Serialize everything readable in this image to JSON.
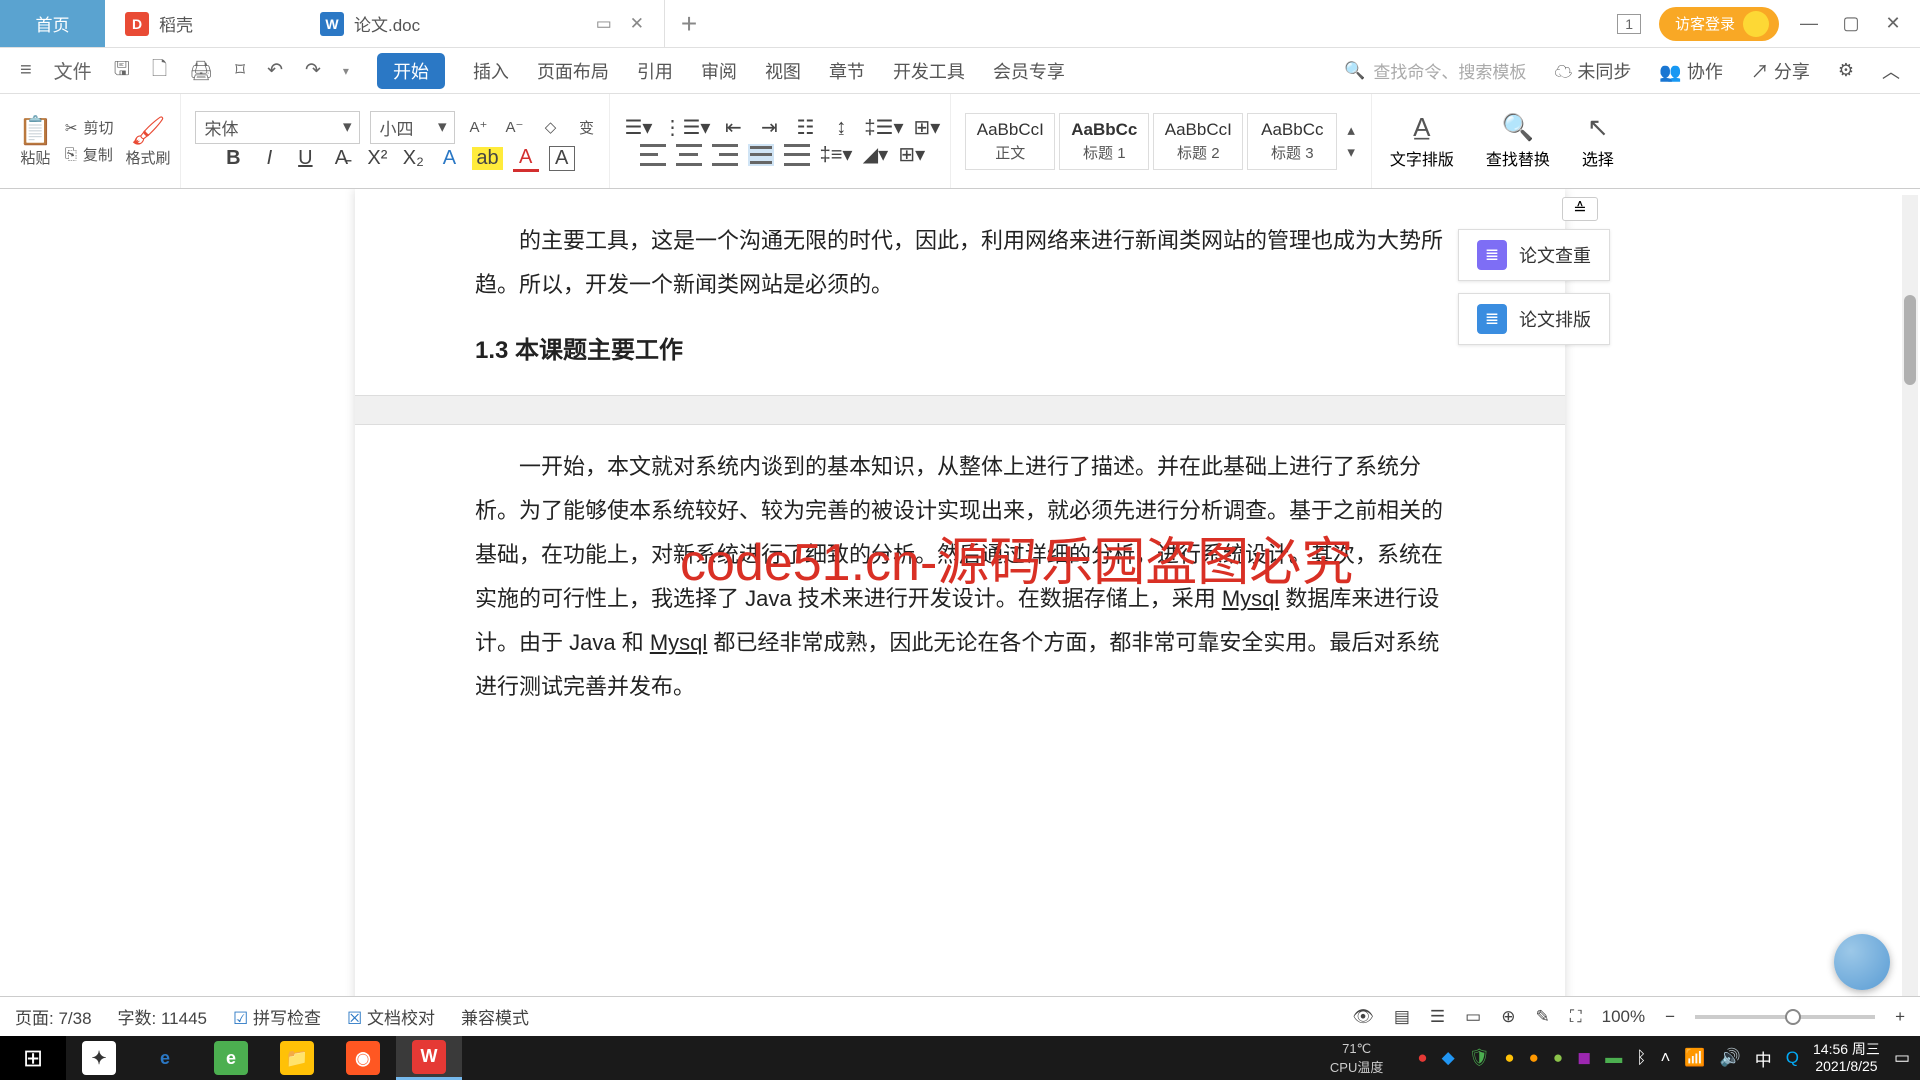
{
  "titlebar": {
    "home": "首页",
    "docer": "稻壳",
    "doc_name": "论文.doc",
    "tab_badge": "1",
    "login": "访客登录"
  },
  "menubar": {
    "file": "文件",
    "items": [
      "开始",
      "插入",
      "页面布局",
      "引用",
      "审阅",
      "视图",
      "章节",
      "开发工具",
      "会员专享"
    ],
    "search_ph": "查找命令、搜索模板",
    "unsync": "未同步",
    "coop": "协作",
    "share": "分享"
  },
  "ribbon": {
    "paste": "粘贴",
    "cut": "剪切",
    "copy": "复制",
    "fmtpaint": "格式刷",
    "font_name": "宋体",
    "font_size": "小四",
    "styles": [
      {
        "sample": "AaBbCcI",
        "name": "正文"
      },
      {
        "sample": "AaBbCc",
        "name": "标题 1"
      },
      {
        "sample": "AaBbCcI",
        "name": "标题 2"
      },
      {
        "sample": "AaBbCc",
        "name": "标题 3"
      }
    ],
    "text_layout": "文字排版",
    "find_replace": "查找替换",
    "select": "选择"
  },
  "document": {
    "p1": "的主要工具，这是一个沟通无限的时代，因此，利用网络来进行新闻类网站的管理也成为大势所趋。所以，开发一个新闻类网站是必须的。",
    "h1": "1.3 本课题主要工作",
    "p2a": "一开始，本文就对系统内谈到的基本知识，从整体上进行了描述。并在此基础上进行了系统分析。为了能够使本系统较好、较为完善的被设计实现出来，就必须先进行分析调查。基于之前相关的基础，在功能上，对新系统进行了细致的分析。然后通过详细的分析，进行系统设计。其次，系统在实施的可行性上，我选择了 Java 技术来进行开发设计。在数据存储上，采用 ",
    "p2b_u1": "Mysql",
    "p2c": " 数据库来进行设计。由于 Java 和 ",
    "p2d_u2": "Mysql",
    "p2e": " 都已经非常成熟，因此无论在各个方面，都非常可靠安全实用。最后对系统进行测试完善并发布。"
  },
  "sidebar": {
    "btn1": "论文查重",
    "btn2": "论文排版"
  },
  "statusbar": {
    "page": "页面: 7/38",
    "words": "字数: 11445",
    "spell": "拼写检查",
    "proof": "文档校对",
    "compat": "兼容模式",
    "zoom": "100%"
  },
  "taskbar": {
    "temp_val": "71℃",
    "temp_lbl": "CPU温度",
    "ime": "中",
    "time": "14:56 周三",
    "date": "2021/8/25"
  },
  "watermark_text": "code51.cn",
  "big_watermark": "code51.cn-源码乐园盗图必究"
}
